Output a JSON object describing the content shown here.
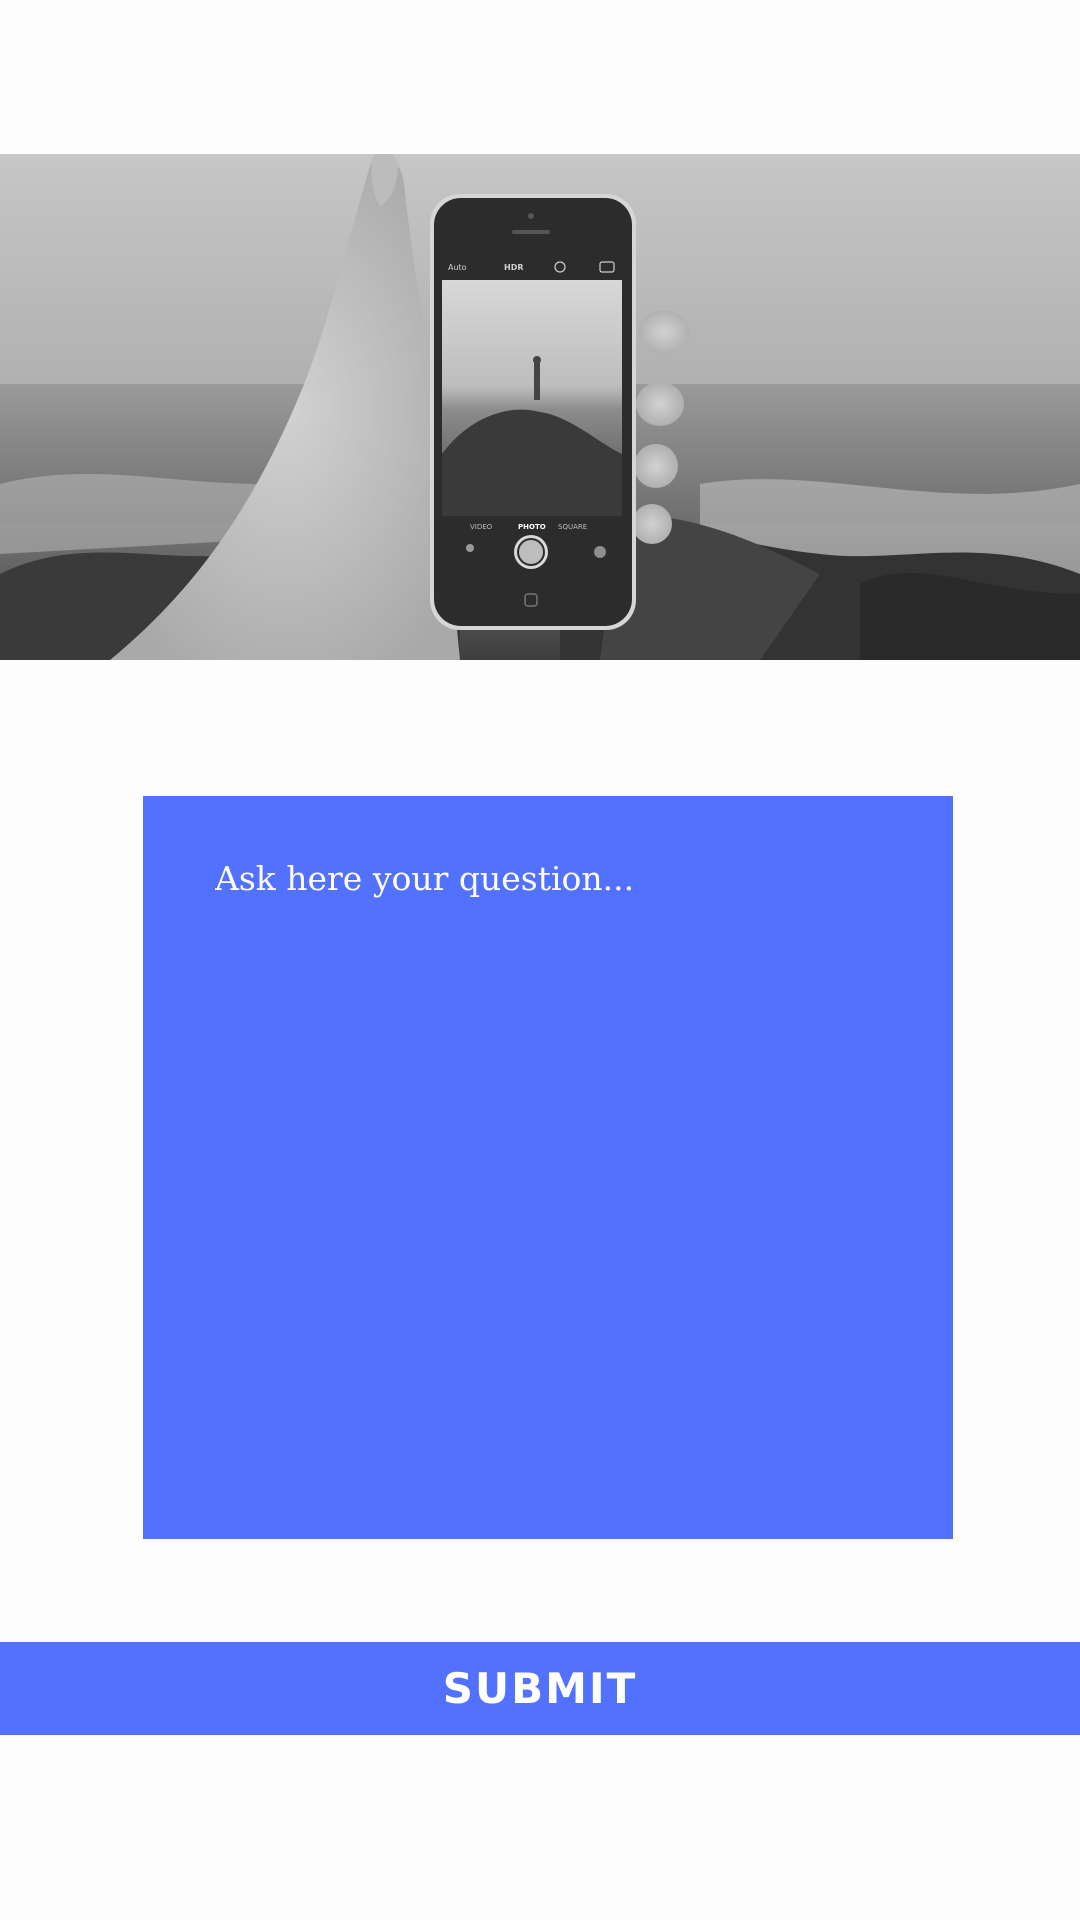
{
  "hero": {
    "photo_icon": "hand-holding-phone-photo",
    "camera_screen": {
      "flash_label": "Auto",
      "hdr_label": "HDR",
      "modes": [
        "VIDEO",
        "PHOTO",
        "SQUARE"
      ]
    }
  },
  "question": {
    "placeholder": "Ask here your question...",
    "value": ""
  },
  "submit": {
    "label": "SUBMIT"
  },
  "colors": {
    "accent": "#5271ff",
    "background": "#fdfdfd",
    "text_on_accent": "#ffffff"
  }
}
